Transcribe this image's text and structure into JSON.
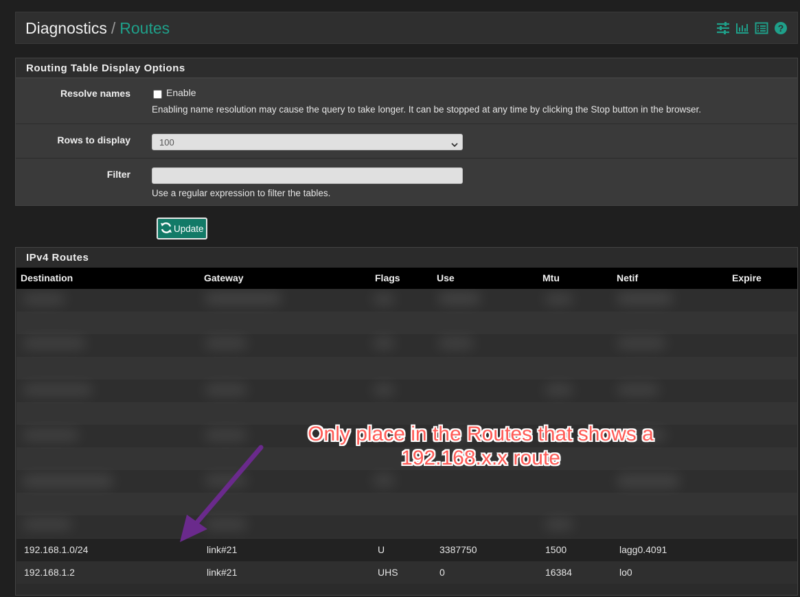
{
  "header": {
    "breadcrumb_root": "Diagnostics",
    "separator": "/",
    "breadcrumb_current": "Routes",
    "icons": [
      "settings-sliders-icon",
      "bar-chart-icon",
      "log-list-icon",
      "help-icon"
    ],
    "accent_color": "#1fa08a"
  },
  "options_panel": {
    "title": "Routing Table Display Options",
    "resolve_names": {
      "label": "Resolve names",
      "checkbox_label": "Enable",
      "checked": false,
      "help": "Enabling name resolution may cause the query to take longer. It can be stopped at any time by clicking the Stop button in the browser."
    },
    "rows_to_display": {
      "label": "Rows to display",
      "selected": "100"
    },
    "filter": {
      "label": "Filter",
      "value": "",
      "help": "Use a regular expression to filter the tables."
    }
  },
  "update_button": {
    "label": "Update",
    "icon": "refresh-icon"
  },
  "routes_panel": {
    "title": "IPv4 Routes",
    "columns": [
      "Destination",
      "Gateway",
      "Flags",
      "Use",
      "Mtu",
      "Netif",
      "Expire"
    ],
    "rows": [
      [
        "192.168.1.0/24",
        "link#21",
        "U",
        "3387750",
        "1500",
        "lagg0.4091",
        ""
      ],
      [
        "192.168.1.2",
        "link#21",
        "UHS",
        "0",
        "16384",
        "lo0",
        ""
      ]
    ]
  },
  "annotation": {
    "line1": "Only place in the Routes that shows a",
    "line2": "192.168.x.x route",
    "text_color": "#ff5a55",
    "arrow_color": "#6a2a8c"
  }
}
